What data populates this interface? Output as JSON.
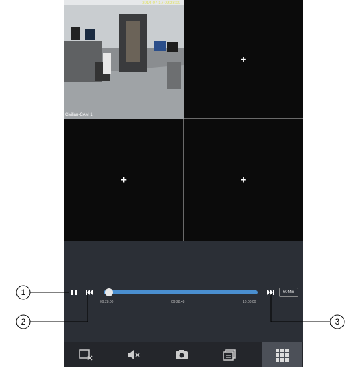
{
  "camera": {
    "name": "Civilian-CAM 1",
    "timestamp": "2014-07-17 09:28:00",
    "empty_slot_glyph": "+"
  },
  "playback": {
    "pause_icon": "pause-icon",
    "prev_icon": "skip-back-icon",
    "next_icon": "skip-forward-icon",
    "progress_fraction": 0.02,
    "time_start": "09:28:00",
    "time_mid": "09:28:48",
    "time_end": "10:00:00",
    "duration_label": "60Min"
  },
  "callouts": {
    "c1": "1",
    "c2": "2",
    "c3": "3"
  },
  "nav": [
    {
      "icon": "close-window-icon"
    },
    {
      "icon": "mute-icon"
    },
    {
      "icon": "camera-icon"
    },
    {
      "icon": "split-icon"
    },
    {
      "icon": "grid-icon"
    }
  ],
  "colors": {
    "accent": "#4a8fd0",
    "panel": "#2b2f36"
  }
}
